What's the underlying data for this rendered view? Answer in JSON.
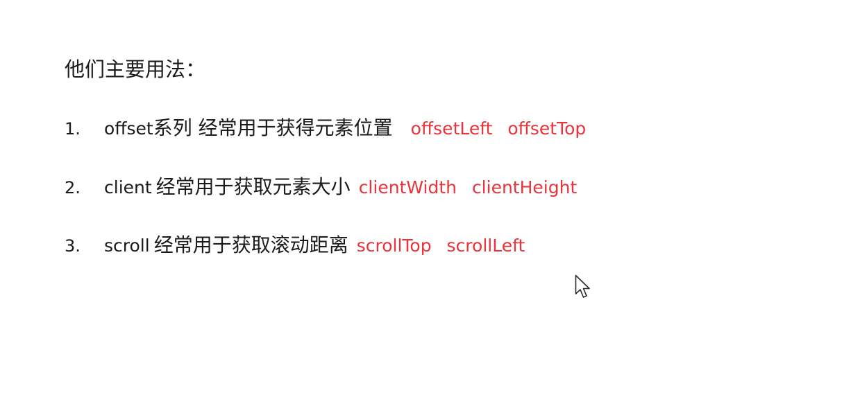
{
  "heading": "他们主要用法：",
  "items": [
    {
      "number": "1.",
      "term": "offset",
      "description": "系列 经常用于获得元素位置",
      "properties": [
        "offsetLeft",
        "offsetTop"
      ]
    },
    {
      "number": "2.",
      "term": "client",
      "description": "经常用于获取元素大小",
      "properties": [
        "clientWidth",
        "clientHeight"
      ]
    },
    {
      "number": "3.",
      "term": "scroll",
      "description": "经常用于获取滚动距离",
      "properties": [
        "scrollTop",
        "scrollLeft"
      ]
    }
  ],
  "colors": {
    "text": "#1a1a1a",
    "property_highlight": "#e8343a",
    "background": "#ffffff"
  },
  "icons": {
    "pointer": "mouse-pointer-icon"
  }
}
